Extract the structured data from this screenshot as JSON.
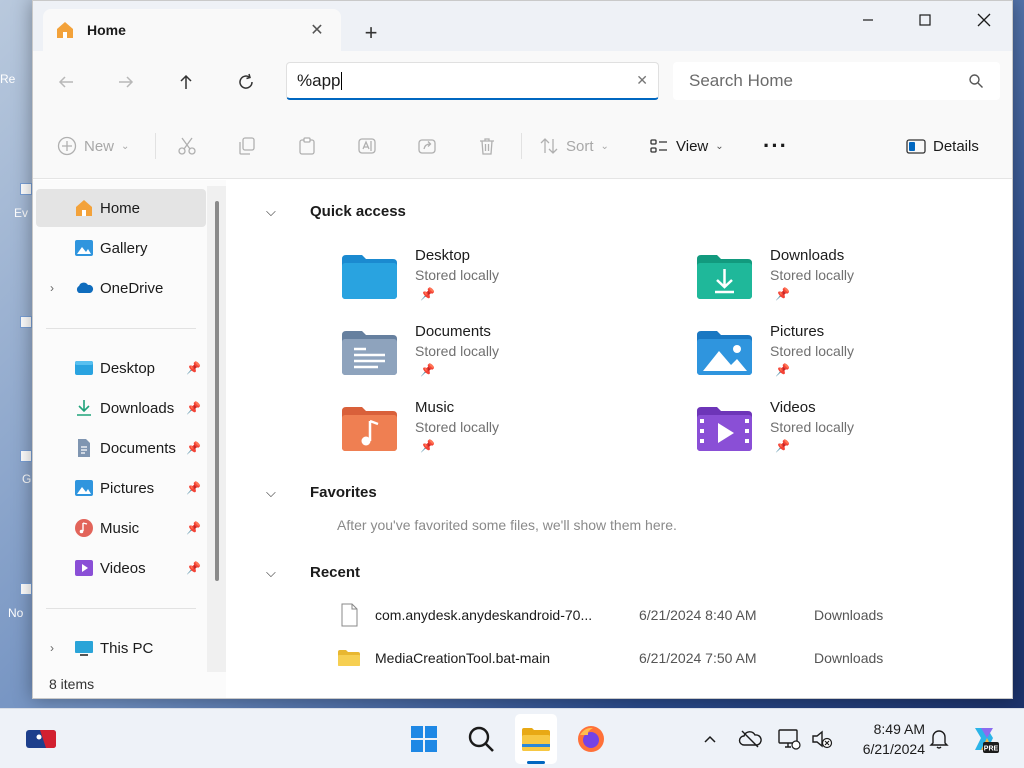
{
  "desktop": {
    "labels": [
      "Re",
      "Ev",
      "G",
      "No"
    ]
  },
  "window": {
    "tab": {
      "title": "Home",
      "icon": "home-icon",
      "close_icon": "close-icon"
    },
    "new_tab_icon": "plus-icon",
    "controls": {
      "minimize": "minimize-icon",
      "maximize": "maximize-icon",
      "close": "close-icon"
    }
  },
  "navbar": {
    "back_icon": "arrow-left-icon",
    "forward_icon": "arrow-right-icon",
    "up_icon": "arrow-up-icon",
    "refresh_icon": "refresh-icon",
    "address_value": "%app",
    "search_placeholder": "Search Home"
  },
  "commandbar": {
    "new_label": "New",
    "sort_label": "Sort",
    "view_label": "View",
    "details_label": "Details",
    "more_icon": "ellipsis-icon"
  },
  "sidebar": {
    "top": [
      {
        "label": "Home",
        "icon": "home-icon",
        "active": true
      },
      {
        "label": "Gallery",
        "icon": "gallery-icon"
      },
      {
        "label": "OneDrive",
        "icon": "cloud-icon",
        "expandable": true
      }
    ],
    "pinned": [
      {
        "label": "Desktop",
        "icon": "desktop-folder-icon"
      },
      {
        "label": "Downloads",
        "icon": "download-icon"
      },
      {
        "label": "Documents",
        "icon": "documents-icon"
      },
      {
        "label": "Pictures",
        "icon": "pictures-icon"
      },
      {
        "label": "Music",
        "icon": "music-icon"
      },
      {
        "label": "Videos",
        "icon": "videos-icon"
      }
    ],
    "this_pc": "This PC",
    "status": "8 items"
  },
  "content": {
    "quick_access": {
      "title": "Quick access",
      "items": [
        {
          "name": "Desktop",
          "sub": "Stored locally",
          "color": "#29a3e0"
        },
        {
          "name": "Downloads",
          "sub": "Stored locally",
          "color": "#1fb89a"
        },
        {
          "name": "Documents",
          "sub": "Stored locally",
          "color": "#7f95b1"
        },
        {
          "name": "Pictures",
          "sub": "Stored locally",
          "color": "#2f95de"
        },
        {
          "name": "Music",
          "sub": "Stored locally",
          "color": "#ef7f52"
        },
        {
          "name": "Videos",
          "sub": "Stored locally",
          "color": "#8a4fd6"
        }
      ]
    },
    "favorites": {
      "title": "Favorites",
      "empty_text": "After you've favorited some files, we'll show them here."
    },
    "recent": {
      "title": "Recent",
      "rows": [
        {
          "name": "com.anydesk.anydeskandroid-70...",
          "date": "6/21/2024 8:40 AM",
          "location": "Downloads",
          "icon": "file-icon"
        },
        {
          "name": "MediaCreationTool.bat-main",
          "date": "6/21/2024 7:50 AM",
          "location": "Downloads",
          "icon": "folder-icon"
        }
      ]
    }
  },
  "taskbar": {
    "clock_time": "8:49 AM",
    "clock_date": "6/21/2024"
  },
  "colors": {
    "accent": "#0067c0",
    "window_bg": "#f9f9f9"
  }
}
